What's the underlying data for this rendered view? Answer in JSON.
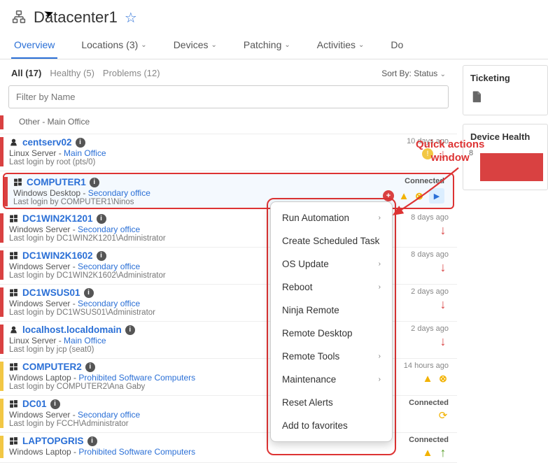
{
  "header": {
    "title": "Datacenter1"
  },
  "tabs": [
    {
      "label": "Overview",
      "active": true,
      "chev": false
    },
    {
      "label": "Locations (3)",
      "chev": true
    },
    {
      "label": "Devices",
      "chev": true
    },
    {
      "label": "Patching",
      "chev": true
    },
    {
      "label": "Activities",
      "chev": true
    },
    {
      "label": "Do",
      "chev": false
    }
  ],
  "filters": {
    "all": "All (17)",
    "healthy": "Healthy (5)",
    "problems": "Problems (12)",
    "sort_label": "Sort By:",
    "sort_value": "Status"
  },
  "search": {
    "placeholder": "Filter by Name"
  },
  "stub0": "Other - Main Office",
  "devices": [
    {
      "bar": "red",
      "icon": "linux",
      "name": "centserv02",
      "type": "Linux Server",
      "loc": "Main Office",
      "last": "Last login by root (pts/0)",
      "time": "10 days ago",
      "icons": [
        "ywarn",
        "down"
      ]
    },
    {
      "bar": "red",
      "icon": "win",
      "name": "COMPUTER1",
      "type": "Windows Desktop",
      "loc": "Secondary office",
      "last": "Last login by COMPUTER1\\Ninos",
      "time": "Connected",
      "icons": [
        "plus",
        "warn",
        "x",
        "play"
      ],
      "hl": true
    },
    {
      "bar": "red",
      "icon": "win",
      "name": "DC1WIN2K1201",
      "type": "Windows Server",
      "loc": "Secondary office",
      "last": "Last login by DC1WIN2K1201\\Administrator",
      "time": "8 days ago",
      "icons": [
        "down"
      ]
    },
    {
      "bar": "red",
      "icon": "win",
      "name": "DC1WIN2K1602",
      "type": "Windows Server",
      "loc": "Secondary office",
      "last": "Last login by DC1WIN2K1602\\Administrator",
      "time": "8 days ago",
      "icons": [
        "down"
      ]
    },
    {
      "bar": "red",
      "icon": "win",
      "name": "DC1WSUS01",
      "type": "Windows Server",
      "loc": "Secondary office",
      "last": "Last login by DC1WSUS01\\Administrator",
      "time": "2 days ago",
      "icons": [
        "down"
      ]
    },
    {
      "bar": "red",
      "icon": "linux",
      "name": "localhost.localdomain",
      "type": "Linux Server",
      "loc": "Main Office",
      "last": "Last login by jcp (seat0)",
      "time": "2 days ago",
      "icons": [
        "down"
      ]
    },
    {
      "bar": "yellow",
      "icon": "win",
      "name": "COMPUTER2",
      "type": "Windows Laptop",
      "loc": "Prohibited Software Computers",
      "last": "Last login by COMPUTER2\\Ana Gaby",
      "time": "14 hours ago",
      "icons": [
        "warn",
        "x"
      ]
    },
    {
      "bar": "yellow",
      "icon": "win",
      "name": "DC01",
      "type": "Windows Server",
      "loc": "Secondary office",
      "last": "Last login by FCCH\\Administrator",
      "time": "Connected",
      "icons": [
        "sync"
      ]
    },
    {
      "bar": "yellow",
      "icon": "win",
      "name": "LAPTOPGRIS",
      "type": "Windows Laptop",
      "loc": "Prohibited Software Computers",
      "last": "",
      "time": "Connected",
      "icons": [
        "warn",
        "up"
      ]
    }
  ],
  "panels": {
    "ticketing": "Ticketing",
    "health": "Device Health",
    "health_y": "8"
  },
  "menu": [
    {
      "label": "Run Automation",
      "sub": true
    },
    {
      "label": "Create Scheduled Task",
      "sub": false
    },
    {
      "label": "OS Update",
      "sub": true
    },
    {
      "label": "Reboot",
      "sub": true
    },
    {
      "label": "Ninja Remote",
      "sub": false
    },
    {
      "label": "Remote Desktop",
      "sub": false
    },
    {
      "label": "Remote Tools",
      "sub": true
    },
    {
      "label": "Maintenance",
      "sub": true
    },
    {
      "label": "Reset Alerts",
      "sub": false
    },
    {
      "label": "Add to favorites",
      "sub": false
    }
  ],
  "annotation": {
    "l1": "Quick actions",
    "l2": "window"
  }
}
